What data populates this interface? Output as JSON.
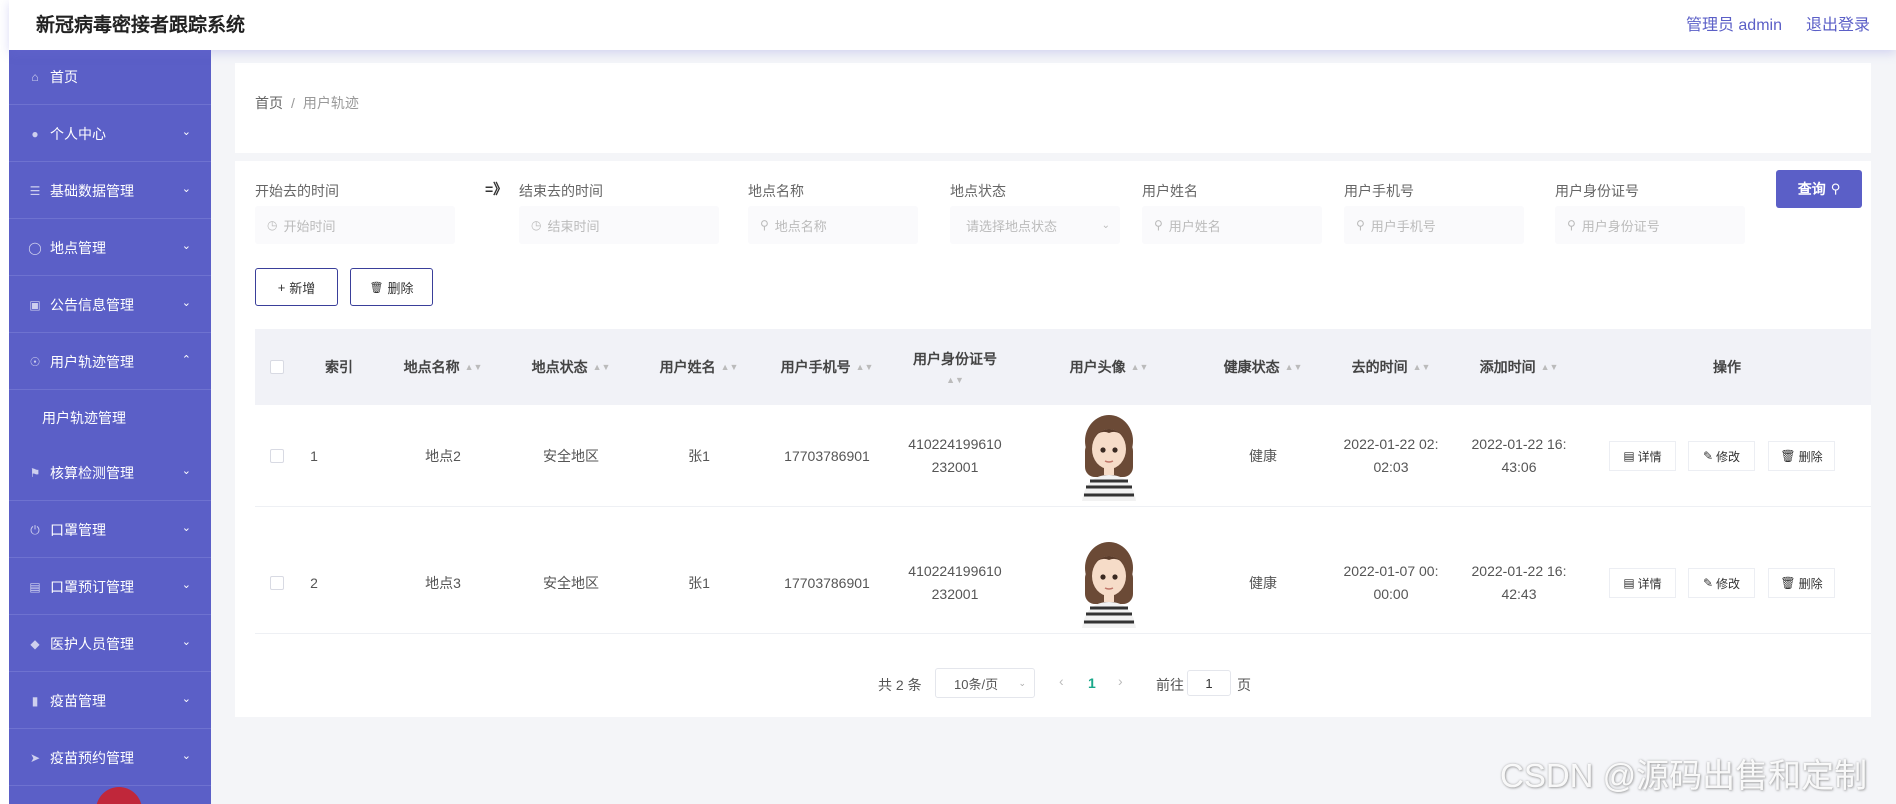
{
  "app": {
    "title": "新冠病毒密接者跟踪系统"
  },
  "header": {
    "user_label": "管理员 admin",
    "logout_label": "退出登录"
  },
  "sidebar": {
    "items": [
      {
        "label": "首页",
        "icon": "home-icon"
      },
      {
        "label": "个人中心",
        "icon": "user-icon"
      },
      {
        "label": "基础数据管理",
        "icon": "sliders-icon"
      },
      {
        "label": "地点管理",
        "icon": "globe-icon"
      },
      {
        "label": "公告信息管理",
        "icon": "briefcase-icon"
      },
      {
        "label": "用户轨迹管理",
        "icon": "compass-icon",
        "expanded": true
      },
      {
        "label": "核算检测管理",
        "icon": "flag-icon"
      },
      {
        "label": "口罩管理",
        "icon": "power-icon"
      },
      {
        "label": "口罩预订管理",
        "icon": "clipboard-icon"
      },
      {
        "label": "医护人员管理",
        "icon": "shield-icon"
      },
      {
        "label": "疫苗管理",
        "icon": "bar-chart-icon"
      },
      {
        "label": "疫苗预约管理",
        "icon": "send-icon"
      }
    ],
    "submenu_label": "用户轨迹管理"
  },
  "breadcrumb": {
    "home": "首页",
    "separator": "/",
    "current": "用户轨迹"
  },
  "filters": {
    "range_symbol": "=》",
    "start_time": {
      "label": "开始去的时间",
      "placeholder": "开始时间"
    },
    "end_time": {
      "label": "结束去的时间",
      "placeholder": "结束时间"
    },
    "place_name": {
      "label": "地点名称",
      "placeholder": "地点名称"
    },
    "place_status": {
      "label": "地点状态",
      "placeholder": "请选择地点状态"
    },
    "user_name": {
      "label": "用户姓名",
      "placeholder": "用户姓名"
    },
    "user_phone": {
      "label": "用户手机号",
      "placeholder": "用户手机号"
    },
    "user_id": {
      "label": "用户身份证号",
      "placeholder": "用户身份证号"
    },
    "query_label": "查询"
  },
  "actions": {
    "add_label": "新增",
    "delete_label": "删除"
  },
  "table": {
    "columns": [
      "索引",
      "地点名称",
      "地点状态",
      "用户姓名",
      "用户手机号",
      "用户身份证号",
      "用户头像",
      "健康状态",
      "去的时间",
      "添加时间",
      "操作"
    ],
    "rows": [
      {
        "index": "1",
        "place": "地点2",
        "status": "安全地区",
        "name": "张1",
        "phone": "17703786901",
        "id_line1": "410224199610",
        "id_line2": "232001",
        "health": "健康",
        "go_line1": "2022-01-22 02:",
        "go_line2": "02:03",
        "add_line1": "2022-01-22 16:",
        "add_line2": "43:06"
      },
      {
        "index": "2",
        "place": "地点3",
        "status": "安全地区",
        "name": "张1",
        "phone": "17703786901",
        "id_line1": "410224199610",
        "id_line2": "232001",
        "health": "健康",
        "go_line1": "2022-01-07 00:",
        "go_line2": "00:00",
        "add_line1": "2022-01-22 16:",
        "add_line2": "42:43"
      }
    ],
    "op_labels": {
      "detail": "详情",
      "edit": "修改",
      "delete": "删除"
    }
  },
  "pagination": {
    "total": "共 2 条",
    "page_size": "10条/页",
    "current": "1",
    "goto_prefix": "前往",
    "goto_value": "1",
    "goto_suffix": "页"
  },
  "watermark": "CSDN @源码出售和定制",
  "colors": {
    "accent": "#5b5fc7",
    "page_active": "#1aa88a"
  }
}
